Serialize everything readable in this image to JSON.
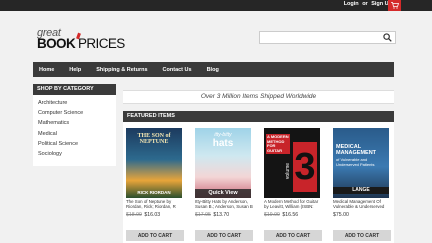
{
  "topbar": {
    "login": "Login",
    "or": "or",
    "signup": "Sign Up"
  },
  "logo": {
    "great": "great",
    "book": "BOOK",
    "prices": "PRICES"
  },
  "search": {
    "placeholder": ""
  },
  "nav": [
    "Home",
    "Help",
    "Shipping & Returns",
    "Contact Us",
    "Blog"
  ],
  "sidebar": {
    "heading": "SHOP BY CATEGORY",
    "items": [
      "Architecture",
      "Computer Science",
      "Mathematics",
      "Medical",
      "Political Science",
      "Sociology"
    ]
  },
  "shipping_banner": "Over 3 Million Items Shipped Worldwide",
  "featured": {
    "heading": "FEATURED ITEMS",
    "quick_view": "Quick View",
    "add_to_cart": "ADD TO CART",
    "products": [
      {
        "title": "The Son of Neptune by Riordan, Rick; Riordan, R (ISBN:",
        "old_price": "$18.99",
        "price": "$16.03",
        "cover_text": [
          "THE SON of NEPTUNE",
          "RICK RIORDAN"
        ]
      },
      {
        "title": "Itty-Bitty Hats by Anderson, Susan B.; Anderson, Susan B",
        "old_price": "$17.95",
        "price": "$13.70",
        "cover_text": [
          "itty-bitty",
          "hats"
        ]
      },
      {
        "title": "A Modern Method for Guitar by Leavitt, William (ISBN:",
        "old_price": "$19.99",
        "price": "$16.56",
        "cover_text": [
          "A MODERN METHOD FOR GUITAR",
          "3",
          "volume"
        ]
      },
      {
        "title": "Medical Management Of Vulnerable & Underserved",
        "old_price": "",
        "price": "$75.00",
        "cover_text": [
          "MEDICAL MANAGEMENT",
          "of Vulnerable and Underserved Patients",
          "LANGE"
        ]
      }
    ]
  },
  "colors": {
    "accent": "#d42a2a",
    "dark": "#3a3a3a",
    "background": "#f1f1f1"
  }
}
